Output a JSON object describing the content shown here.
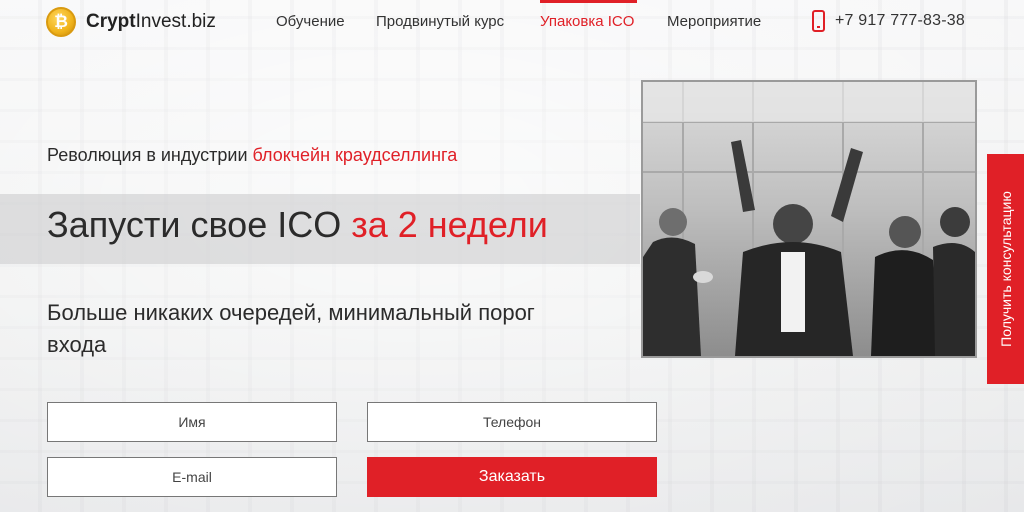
{
  "brand": {
    "logo_symbol": "₿",
    "name_bold": "Crypt",
    "name_rest": "Invest.biz"
  },
  "nav": {
    "items": [
      "Обучение",
      "Продвинутый курс",
      "Упаковка ICO",
      "Мероприятие"
    ],
    "active_index": 2
  },
  "contact": {
    "phone": "+7 917 777-83-38"
  },
  "hero": {
    "subhead_prefix": "Революция в индустрии ",
    "subhead_accent": "блокчейн краудселлинга",
    "title_prefix": "Запусти свое ICO ",
    "title_accent": "за 2 недели",
    "lead": "Больше никаких очередей, минимальный порог входа"
  },
  "form": {
    "name_placeholder": "Имя",
    "phone_placeholder": "Телефон",
    "email_placeholder": "E-mail",
    "submit_label": "Заказать"
  },
  "side_tab": {
    "label": "Получить консультацию"
  },
  "colors": {
    "accent": "#e02027",
    "text": "#2b2b2b"
  }
}
